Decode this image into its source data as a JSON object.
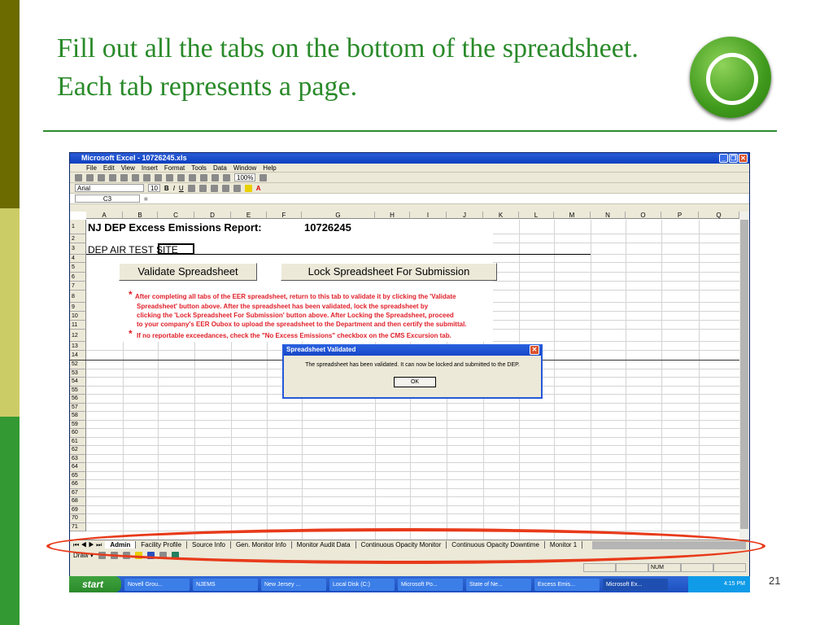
{
  "slide": {
    "title": "Fill out all the tabs on the bottom of the spreadsheet. Each tab represents a page.",
    "page_number": "21"
  },
  "excel": {
    "title": "Microsoft Excel - 10726245.xls",
    "menu": [
      "File",
      "Edit",
      "View",
      "Insert",
      "Format",
      "Tools",
      "Data",
      "Window",
      "Help"
    ],
    "zoom": "100%",
    "font": "Arial",
    "font_size": "10",
    "cell_ref": "C3",
    "formula_eq": "=",
    "columns": [
      "A",
      "B",
      "C",
      "D",
      "E",
      "F",
      "G",
      "H",
      "I",
      "J",
      "K",
      "L",
      "M",
      "N",
      "O",
      "P",
      "Q"
    ],
    "rows": [
      "1",
      "2",
      "3",
      "4",
      "5",
      "6",
      "7",
      "8",
      "9",
      "10",
      "11",
      "12",
      "13",
      "14",
      "52",
      "53",
      "54",
      "55",
      "56",
      "57",
      "58",
      "59",
      "60",
      "61",
      "62",
      "63",
      "64",
      "65",
      "66",
      "67",
      "68",
      "69",
      "70",
      "71"
    ],
    "report_title": "NJ DEP Excess Emissions Report:",
    "report_id": "10726245",
    "site_name": "DEP AIR TEST SITE",
    "validate_button": "Validate Spreadsheet",
    "lock_button": "Lock Spreadsheet For Submission",
    "instructions": [
      "After completing all tabs of the EER spreadsheet, return to this tab to validate it by clicking the 'Validate",
      "Spreadsheet' button above.  After the spreadsheet has been validated, lock the spreadsheet by",
      "clicking the 'Lock Spreadsheet For Submission' button above. After Locking the Spreadsheet, proceed",
      "to your company's EER Oubox to upload the spreadsheet to the Department and then certify the submittal."
    ],
    "note": "If no reportable exceedances, check the \"No Excess Emissions\" checkbox on the CMS Excursion tab.",
    "asterisk": "*",
    "dialog": {
      "title": "Spreadsheet Validated",
      "message": "The spreadsheet has been validated.  It can now be locked and submitted to the DEP.",
      "ok": "OK"
    },
    "tabs": [
      "Admin",
      "Facility Profile",
      "Source Info",
      "Gen. Monitor Info",
      "Monitor Audit Data",
      "Continuous Opacity Monitor",
      "Continuous Opacity Downtime",
      "Monitor 1"
    ],
    "draw_label": "Draw ▾",
    "status_num": "NUM"
  },
  "taskbar": {
    "start": "start",
    "items": [
      "Novell Grou...",
      "NJEMS",
      "New Jersey ...",
      "Local Disk (C:)",
      "Microsoft Po...",
      "State of Ne...",
      "Excess Emis...",
      "Microsoft Ex..."
    ],
    "clock": "4:15 PM"
  }
}
